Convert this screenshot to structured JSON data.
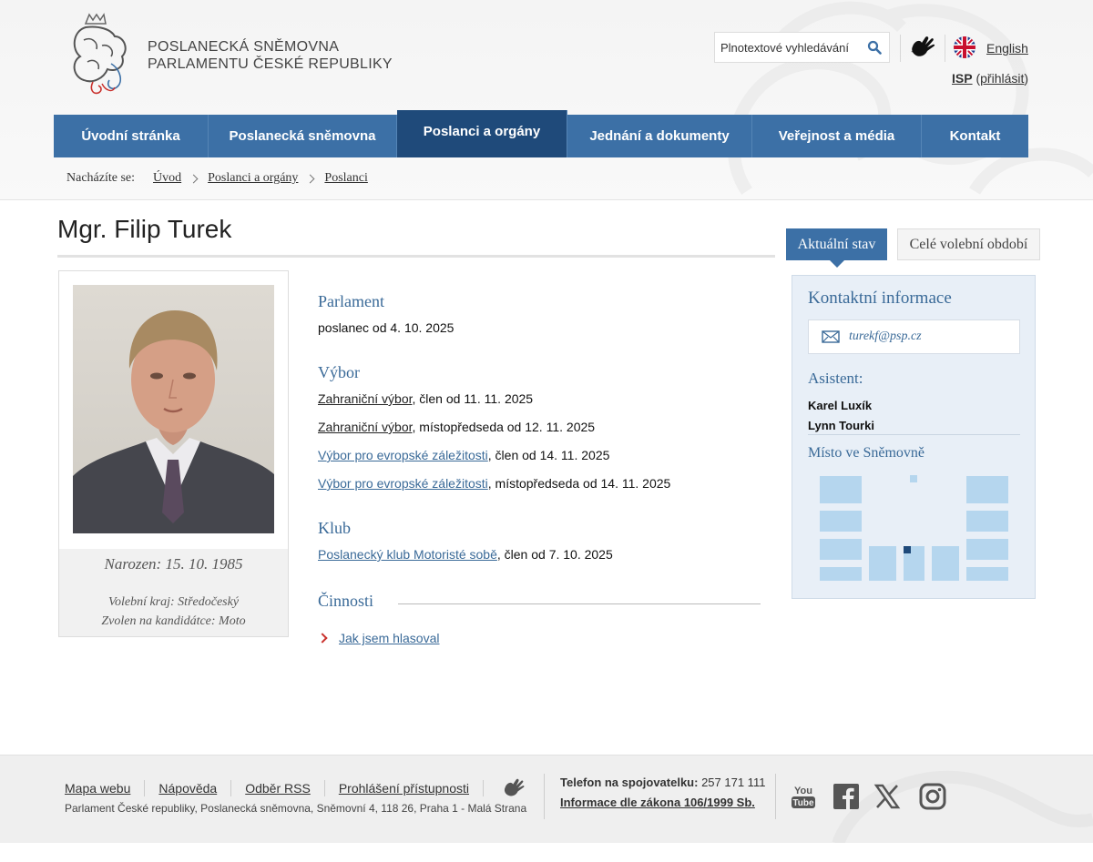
{
  "header": {
    "logo_line1": "POSLANECKÁ SNĚMOVNA",
    "logo_line2": "PARLAMENTU ČESKÉ REPUBLIKY",
    "search_placeholder": "Plnotextové vyhledávání",
    "language_link": "English",
    "isp_label": "ISP",
    "isp_open": "(",
    "isp_login": "přihlásit",
    "isp_close": ")"
  },
  "nav": {
    "items": [
      {
        "label": "Úvodní stránka"
      },
      {
        "label": "Poslanecká sněmovna"
      },
      {
        "label": "Poslanci a orgány"
      },
      {
        "label": "Jednání a dokumenty"
      },
      {
        "label": "Veřejnost a média"
      },
      {
        "label": "Kontakt"
      }
    ],
    "active_index": 2
  },
  "breadcrumb": {
    "label": "Nacházíte se:",
    "items": [
      "Úvod",
      "Poslanci a orgány",
      "Poslanci"
    ]
  },
  "profile": {
    "name": "Mgr. Filip Turek",
    "born": "Narozen: 15. 10. 1985",
    "region": "Volební kraj: Středočeský",
    "candidacy": "Zvolen na kandidátce: Moto"
  },
  "sections": {
    "parlament": {
      "title": "Parlament",
      "text": "poslanec od 4. 10. 2025"
    },
    "vybor": {
      "title": "Výbor",
      "rows": [
        {
          "link": "Zahraniční výbor",
          "text": ", člen od 11. 11. 2025"
        },
        {
          "link": "Zahraniční výbor",
          "text": ", místopředseda od 12. 11. 2025"
        },
        {
          "link": "Výbor pro evropské záležitosti",
          "text": ", člen od 14. 11. 2025"
        },
        {
          "link": "Výbor pro evropské záležitosti",
          "text": ", místopředseda od 14. 11. 2025"
        }
      ]
    },
    "klub": {
      "title": "Klub",
      "link": "Poslanecký klub Motoristé sobě",
      "text": ", člen od 7. 10. 2025"
    },
    "cinnosti": {
      "title": "Činnosti",
      "link": "Jak jsem hlasoval"
    }
  },
  "tabs": {
    "active": "Aktuální stav",
    "inactive": "Celé volební období"
  },
  "contact": {
    "title": "Kontaktní informace",
    "email": "turekf@psp.cz",
    "assistant_heading": "Asistent:",
    "assistants": [
      "Karel Luxík",
      "Lynn Tourki"
    ],
    "seat_heading": "Místo ve Sněmovně"
  },
  "footer": {
    "links": [
      "Mapa webu",
      "Nápověda",
      "Odběr RSS",
      "Prohlášení přístupnosti"
    ],
    "address": "Parlament České republiky, Poslanecká sněmovna, Sněmovní 4, 118 26, Praha 1 - Malá Strana",
    "phone_label": "Telefon na spojovatelku:",
    "phone": "257 171 111",
    "law_link": "Informace dle zákona 106/1999 Sb.",
    "social": [
      "youtube-icon",
      "facebook-icon",
      "x-icon",
      "instagram-icon"
    ]
  },
  "colors": {
    "nav": "#3c70a6",
    "nav_active": "#1f4a7a",
    "heading_blue": "#3a6a98",
    "seat_light": "#b5d6ee",
    "seat_highlight": "#1f4a7a"
  }
}
